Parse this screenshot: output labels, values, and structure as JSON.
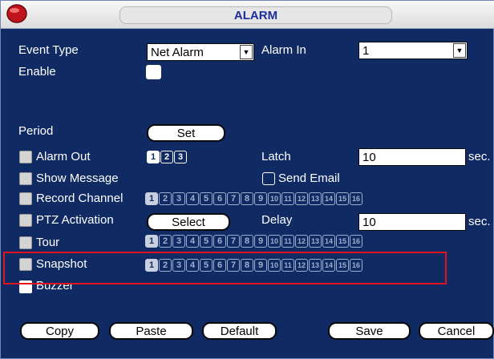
{
  "window": {
    "title": "ALARM"
  },
  "labels": {
    "event_type": "Event Type",
    "alarm_in": "Alarm In",
    "enable": "Enable",
    "period": "Period",
    "alarm_out": "Alarm Out",
    "latch": "Latch",
    "sec1": "sec.",
    "show_message": "Show Message",
    "send_email": "Send Email",
    "record_channel": "Record Channel",
    "ptz_activation": "PTZ Activation",
    "delay": "Delay",
    "sec2": "sec.",
    "tour": "Tour",
    "snapshot": "Snapshot",
    "buzzer": "Buzzer"
  },
  "fields": {
    "event_type_value": "Net Alarm",
    "alarm_in_value": "1",
    "latch_value": "10",
    "delay_value": "10"
  },
  "buttons": {
    "set": "Set",
    "select": "Select",
    "copy": "Copy",
    "paste": "Paste",
    "default": "Default",
    "save": "Save",
    "cancel": "Cancel"
  },
  "alarm_out_channels": [
    "1",
    "2",
    "3"
  ],
  "channels_16": [
    "1",
    "2",
    "3",
    "4",
    "5",
    "6",
    "7",
    "8",
    "9",
    "10",
    "11",
    "12",
    "13",
    "14",
    "15",
    "16"
  ],
  "colors": {
    "background": "#102a63",
    "title_text": "#1c2e9c",
    "highlight": "#e0141e"
  }
}
